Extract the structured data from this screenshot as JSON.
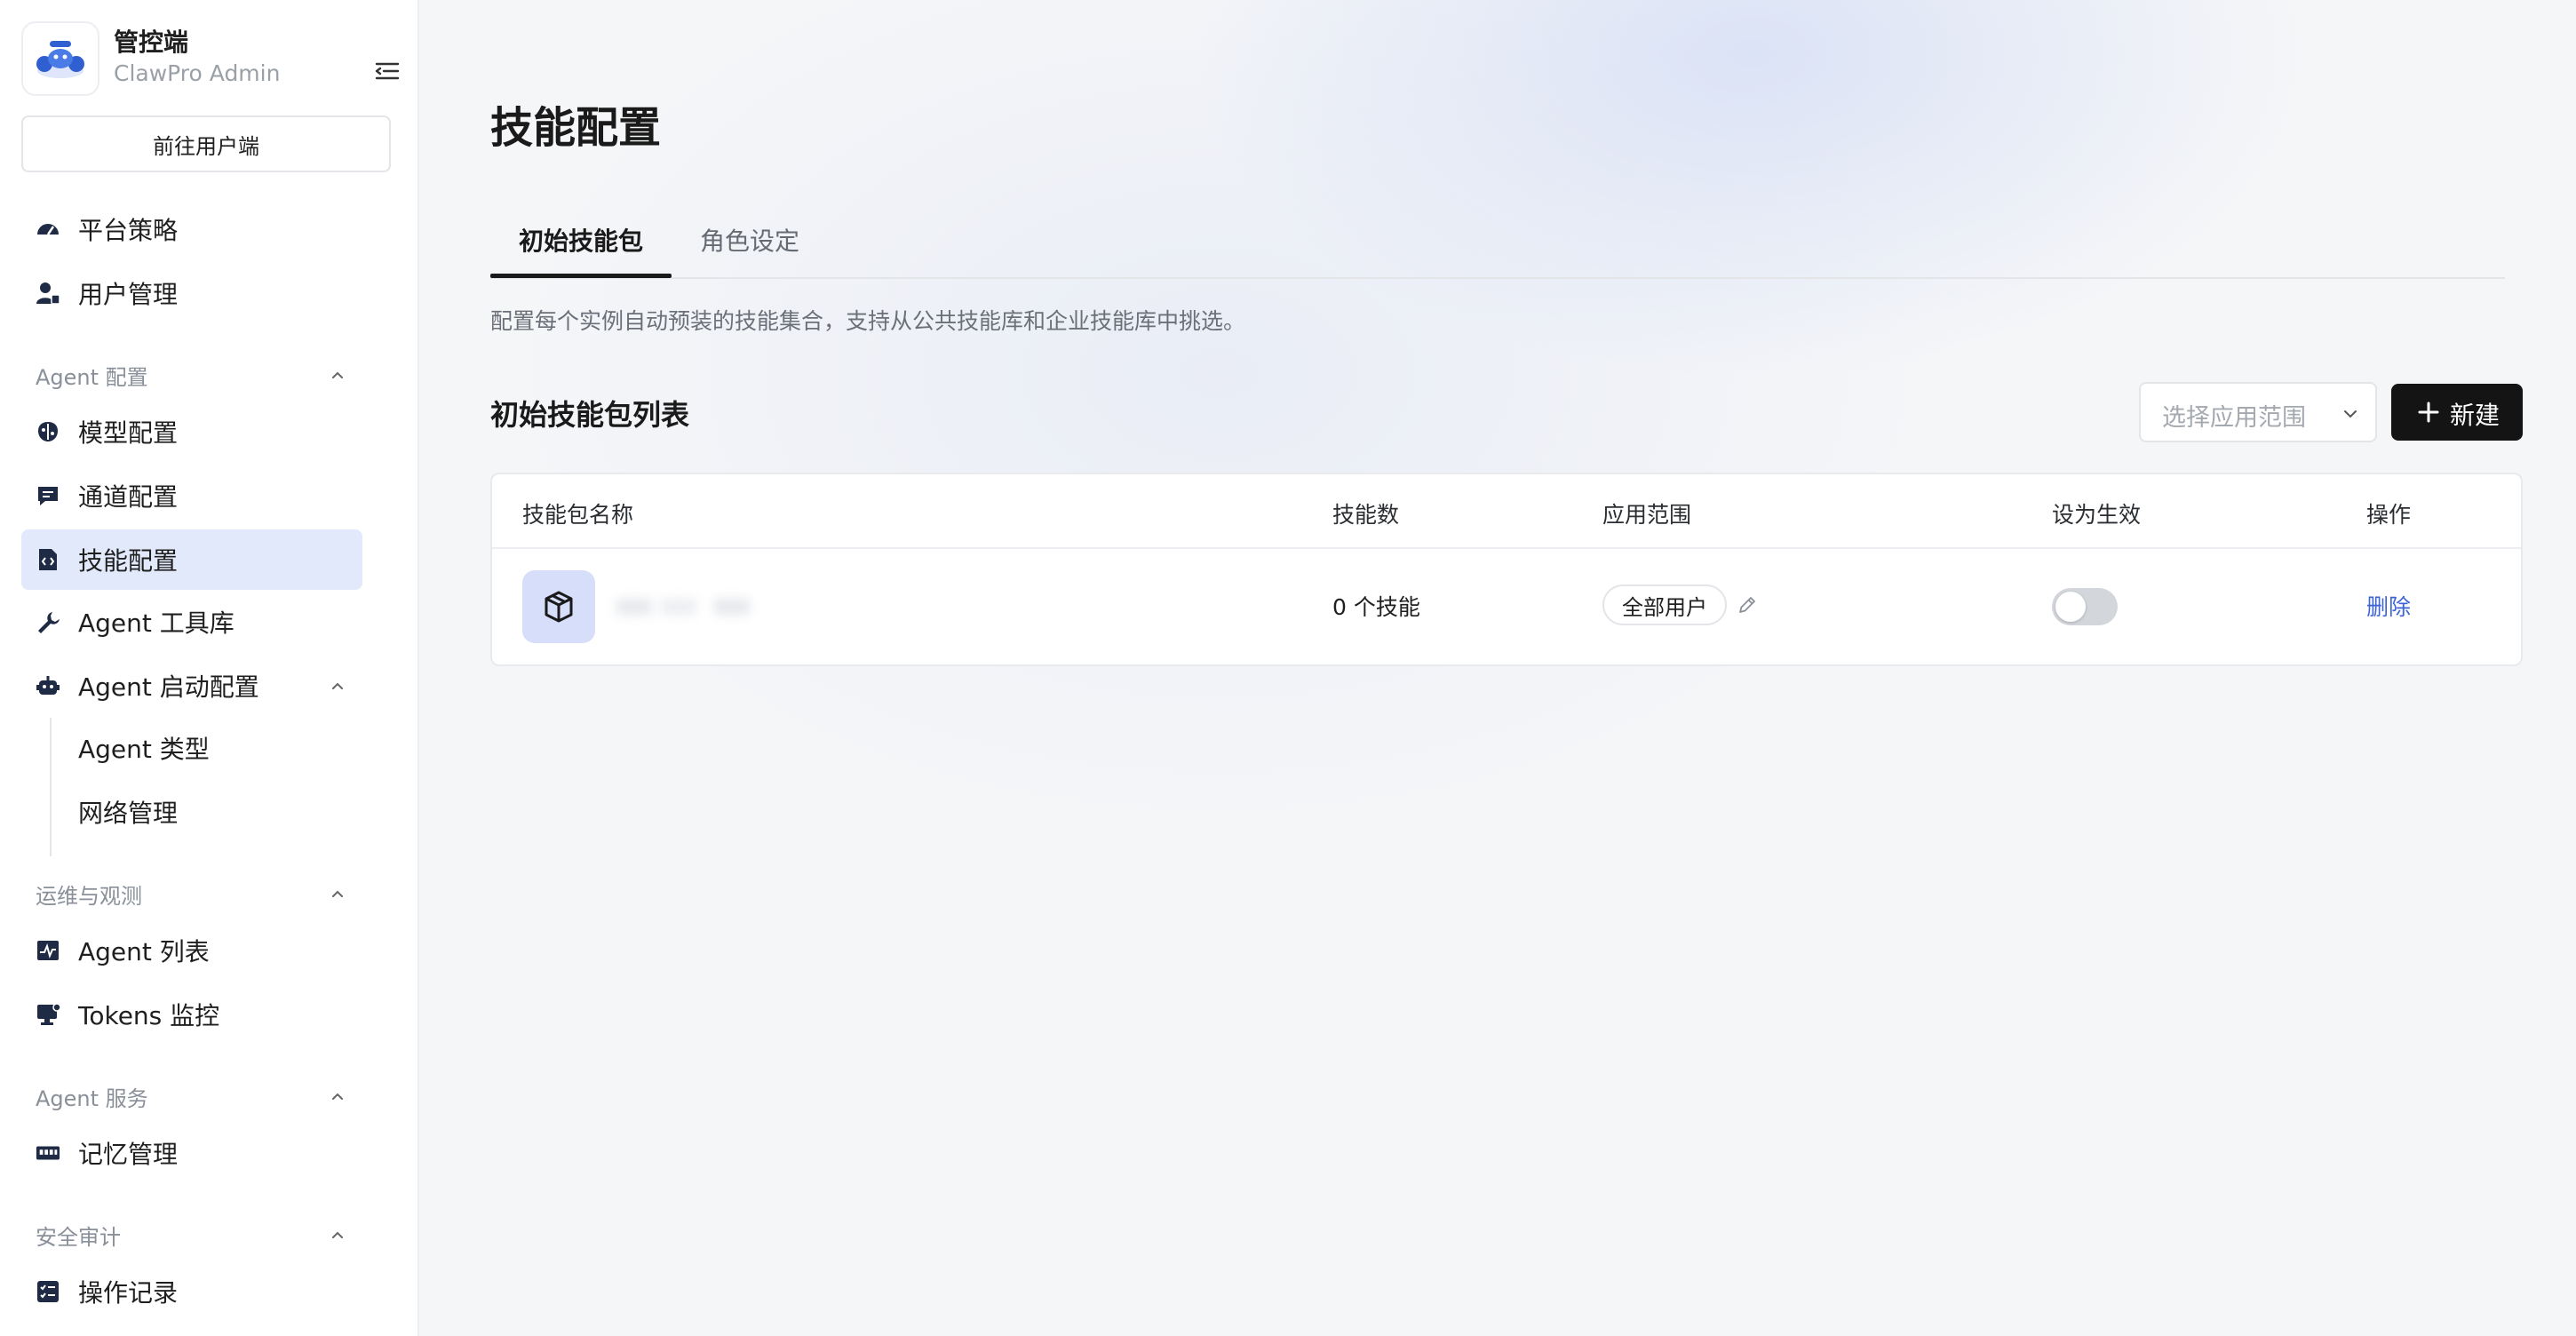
{
  "brand": {
    "title": "管控端",
    "subtitle": "ClawPro Admin"
  },
  "sidebar": {
    "goto_label": "前往用户端",
    "items": {
      "platform_policy": "平台策略",
      "user_mgmt": "用户管理",
      "model_config": "模型配置",
      "channel_config": "通道配置",
      "skill_config": "技能配置",
      "agent_toolbox": "Agent 工具库",
      "agent_boot_config": "Agent 启动配置",
      "agent_type": "Agent 类型",
      "network_mgmt": "网络管理",
      "agent_list": "Agent 列表",
      "tokens_monitor": "Tokens 监控",
      "memory_mgmt": "记忆管理",
      "operation_log": "操作记录"
    },
    "groups": {
      "agent_config": "Agent 配置",
      "ops_observe": "运维与观测",
      "agent_service": "Agent 服务",
      "security_audit": "安全审计"
    },
    "active": "skill_config"
  },
  "main": {
    "title": "技能配置",
    "tabs": [
      {
        "label": "初始技能包",
        "active": true
      },
      {
        "label": "角色设定",
        "active": false
      }
    ],
    "description": "配置每个实例自动预装的技能集合，支持从公共技能库和企业技能库中挑选。",
    "list_title": "初始技能包列表",
    "scope_select_placeholder": "选择应用范围",
    "new_button_label": "新建",
    "table": {
      "columns": [
        "技能包名称",
        "技能数",
        "应用范围",
        "设为生效",
        "操作"
      ],
      "rows": [
        {
          "name": "",
          "skill_count": "0 个技能",
          "scope": "全部用户",
          "active": false,
          "action": "删除"
        }
      ]
    }
  },
  "colors": {
    "accent_active_bg": "#e2e9fb",
    "primary_button": "#141414",
    "link": "#3b63d6",
    "icon_tile": "#d6defa"
  }
}
